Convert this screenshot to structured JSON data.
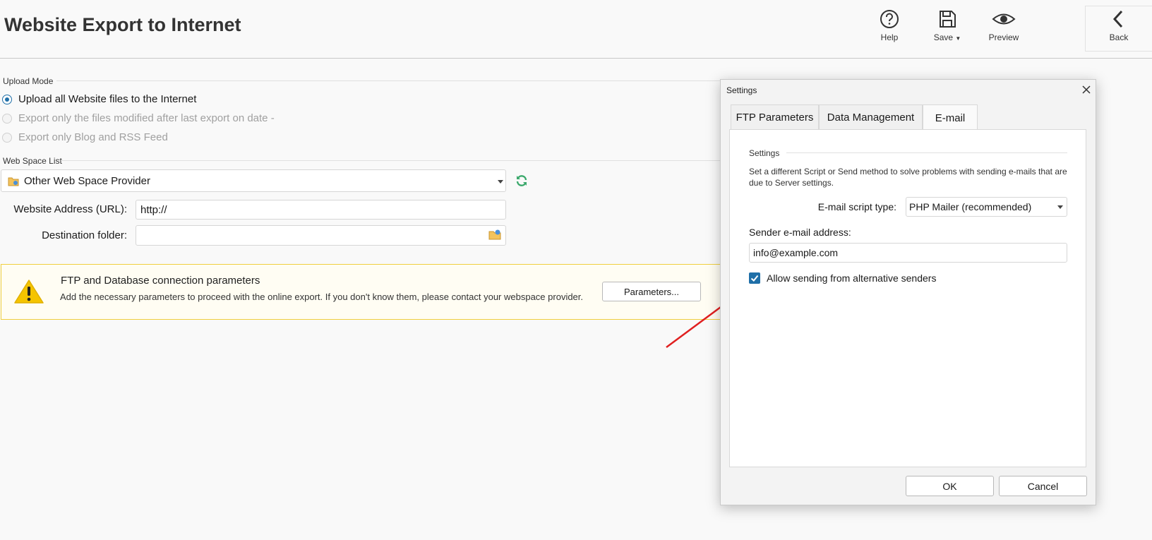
{
  "header": {
    "title": "Website Export to Internet",
    "toolbar": {
      "help_label": "Help",
      "save_label": "Save",
      "preview_label": "Preview",
      "back_label": "Back"
    }
  },
  "upload_mode": {
    "section_title": "Upload Mode",
    "options": [
      {
        "label": "Upload all Website files to the Internet",
        "selected": true,
        "enabled": true
      },
      {
        "label": "Export only the files modified after last export on date -",
        "selected": false,
        "enabled": false
      },
      {
        "label": "Export only Blog and RSS Feed",
        "selected": false,
        "enabled": false
      }
    ]
  },
  "web_space": {
    "section_title": "Web Space List",
    "provider_selected": "Other Web Space Provider",
    "website_address_label": "Website Address (URL):",
    "website_address_value": "http://",
    "destination_folder_label": "Destination folder:",
    "destination_folder_value": ""
  },
  "ftp_notice": {
    "title": "FTP and Database connection parameters",
    "description": "Add the necessary parameters to proceed with the online export. If you don't know them, please contact your webspace provider.",
    "button_label": "Parameters..."
  },
  "dialog": {
    "title": "Settings",
    "tabs": [
      {
        "label": "FTP Parameters",
        "active": false
      },
      {
        "label": "Data Management",
        "active": false
      },
      {
        "label": "E-mail",
        "active": true
      }
    ],
    "group_title": "Settings",
    "description": "Set a different Script or Send method to solve problems with sending e-mails that are due to Server settings.",
    "script_type_label": "E-mail script type:",
    "script_type_value": "PHP Mailer (recommended)",
    "sender_label": "Sender e-mail address:",
    "sender_value": "info@example.com",
    "alt_senders_label": "Allow sending from alternative senders",
    "alt_senders_checked": true,
    "ok_label": "OK",
    "cancel_label": "Cancel"
  },
  "colors": {
    "accent": "#1f6fa8",
    "warning": "#f5c400",
    "annotation_arrow": "#e02020",
    "refresh_icon": "#3aa86b"
  }
}
